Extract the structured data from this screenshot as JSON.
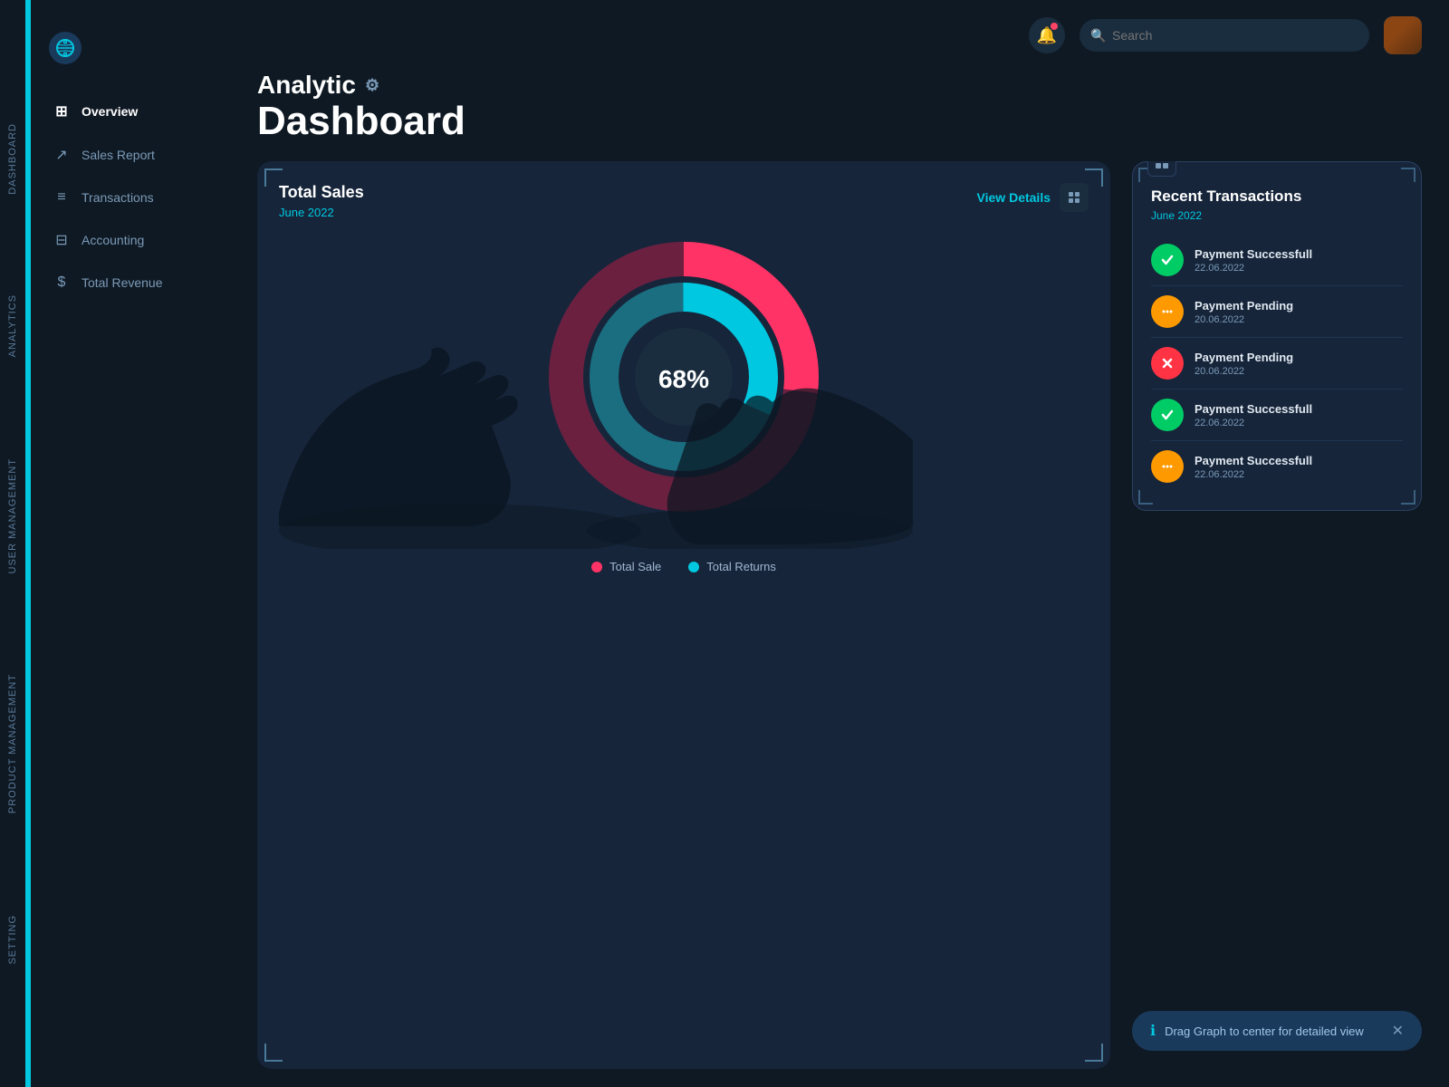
{
  "app": {
    "logo_icon": "🌐",
    "title_top": "Analytic",
    "title_main": "Dashboard",
    "gear_icon": "⚙"
  },
  "sidebar": {
    "items": [
      {
        "id": "overview",
        "label": "Overview",
        "icon": "⊞",
        "active": true
      },
      {
        "id": "sales-report",
        "label": "Sales Report",
        "icon": "↗",
        "active": false
      },
      {
        "id": "transactions",
        "label": "Transactions",
        "icon": "≡",
        "active": false
      },
      {
        "id": "accounting",
        "label": "Accounting",
        "icon": "⊟",
        "active": false
      },
      {
        "id": "total-revenue",
        "label": "Total Revenue",
        "icon": "$",
        "active": false
      }
    ],
    "section_labels": [
      "Dashboard",
      "Analytics",
      "User Management",
      "Product Management",
      "Setting"
    ]
  },
  "header": {
    "search_placeholder": "Search",
    "bell_icon": "🔔"
  },
  "chart": {
    "title": "Total Sales",
    "subtitle": "June 2022",
    "view_details": "View Details",
    "percentage": "68%",
    "legend": [
      {
        "label": "Total Sale",
        "color": "#ff3366"
      },
      {
        "label": "Total Returns",
        "color": "#00c8e0"
      }
    ],
    "donut": {
      "total_sale_pct": 68,
      "total_return_pct": 32
    }
  },
  "transactions": {
    "title": "Recent Transactions",
    "month": "June 2022",
    "items": [
      {
        "status": "success",
        "label": "Payment Successfull",
        "date": "22.06.2022",
        "icon": "✓"
      },
      {
        "status": "pending-orange",
        "label": "Payment Pending",
        "date": "20.06.2022",
        "icon": "•••"
      },
      {
        "status": "pending-red",
        "label": "Payment Pending",
        "date": "20.06.2022",
        "icon": "✕"
      },
      {
        "status": "success",
        "label": "Payment Successfull",
        "date": "22.06.2022",
        "icon": "✓"
      },
      {
        "status": "pending-orange",
        "label": "Payment Successfull",
        "date": "22.06.2022",
        "icon": "•••"
      }
    ]
  },
  "toast": {
    "message": "Drag Graph to center for detailed view",
    "icon": "ℹ",
    "close": "✕"
  },
  "colors": {
    "accent": "#00c8e0",
    "bg_dark": "#0f1923",
    "bg_card": "#16253a",
    "success": "#00cc66",
    "pending_orange": "#ff9900",
    "pending_red": "#ff3344",
    "donut_sale": "#ff3366",
    "donut_return": "#00c8e0",
    "donut_dark": "#6b2040"
  }
}
